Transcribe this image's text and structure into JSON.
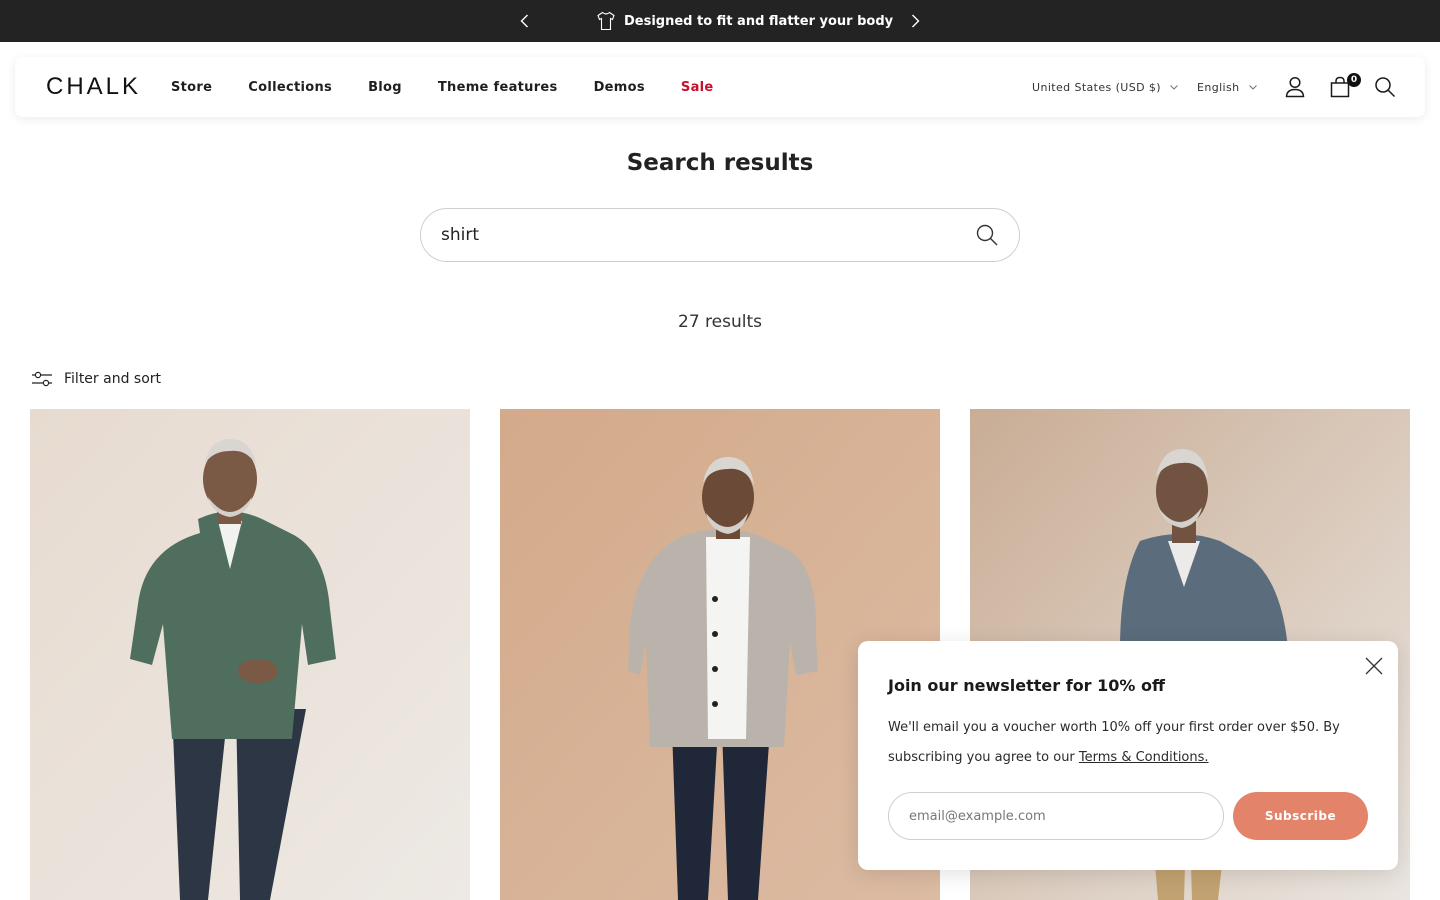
{
  "announcement": {
    "message": "Designed to fit and flatter your body",
    "icon": "tshirt-icon"
  },
  "header": {
    "logo": "CHALK",
    "nav": [
      "Store",
      "Collections",
      "Blog",
      "Theme features",
      "Demos",
      "Sale"
    ],
    "sale_color": "#c8102e",
    "currency": "United States (USD $)",
    "language": "English",
    "cart_count": "0"
  },
  "main": {
    "title": "Search results",
    "search_query": "shirt",
    "results_count": "27 results",
    "filter_label": "Filter and sort"
  },
  "products": [
    {
      "image": "man-in-green-short-sleeve-shirt",
      "shirt_color": "#4f6e5e"
    },
    {
      "image": "man-in-grey-short-sleeve-shirt",
      "shirt_color": "#b9b3ab"
    },
    {
      "image": "man-in-blue-grey-shirt",
      "shirt_color": "#5b6d7c"
    }
  ],
  "newsletter": {
    "title": "Join our newsletter for 10% off",
    "body": "We'll email you a voucher worth 10% off your first order over $50. By subscribing you agree to our ",
    "terms_link": "Terms & Conditions.",
    "email_placeholder": "email@example.com",
    "subscribe_label": "Subscribe",
    "accent": "#e2836a"
  }
}
